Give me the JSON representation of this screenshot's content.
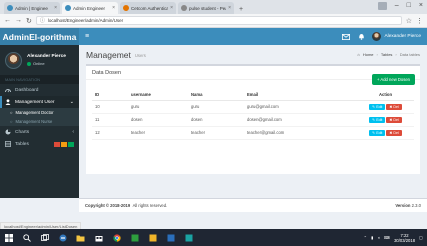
{
  "browser": {
    "tabs": [
      {
        "label": "Admin | Enginee",
        "active": false
      },
      {
        "label": "Admin Engineer",
        "active": true
      },
      {
        "label": "Cetcom Authenticati",
        "active": false
      },
      {
        "label": "pulse student - Pearto",
        "active": false
      }
    ],
    "url": "localhost/Engineer/admin/Admin/User"
  },
  "sidebar": {
    "brand": "AdminEl-gorithma",
    "user": {
      "name": "Alexander Pierce",
      "status": "Online"
    },
    "section_header": "MAIN NAVIGATION",
    "items": [
      {
        "label": "Dashboard",
        "icon": "dashboard-icon",
        "active": false
      },
      {
        "label": "Management User",
        "icon": "users-icon",
        "active": true,
        "children": [
          {
            "label": "Management Doctor",
            "active": true
          },
          {
            "label": "Management Nurse",
            "active": false
          }
        ]
      },
      {
        "label": "Charts",
        "icon": "pie-chart-icon",
        "active": false
      },
      {
        "label": "Tables",
        "icon": "table-icon",
        "active": false
      }
    ]
  },
  "navbar": {
    "user_name": "Alexander Pierce"
  },
  "page": {
    "title": "Managemet",
    "subtitle": "Users",
    "breadcrumb": [
      "Home",
      "Tables",
      "Data tables"
    ]
  },
  "box": {
    "title": "Data Dosen",
    "add_button": "+ Add new Dosen"
  },
  "table": {
    "headers": [
      "ID",
      "username",
      "Nama",
      "Email",
      "Action"
    ],
    "rows": [
      {
        "id": "10",
        "username": "guru",
        "nama": "guru",
        "email": "guru@gmail.com"
      },
      {
        "id": "11",
        "username": "dosen",
        "nama": "dosen",
        "email": "dosen@gmail.com"
      },
      {
        "id": "12",
        "username": "teacher",
        "nama": "teacher",
        "email": "teacher@gmail.com"
      }
    ],
    "edit_label": "Edit",
    "delete_label": "Del"
  },
  "footer": {
    "copyright_prefix": "Copyright © 2018-2019",
    "brand": "",
    "rights": "All rights reserved.",
    "version_label": "Version",
    "version": "2.3.0"
  },
  "statusbar": {
    "text": "localhost/Engineer/admin/User/ListDosen"
  },
  "taskbar": {
    "time": "7:22",
    "date": "30/03/2018"
  },
  "colors": {
    "primary": "#3c8dbc",
    "sidebar": "#222d32",
    "success": "#00a65a",
    "info": "#00c0ef",
    "danger": "#dd4b39"
  }
}
